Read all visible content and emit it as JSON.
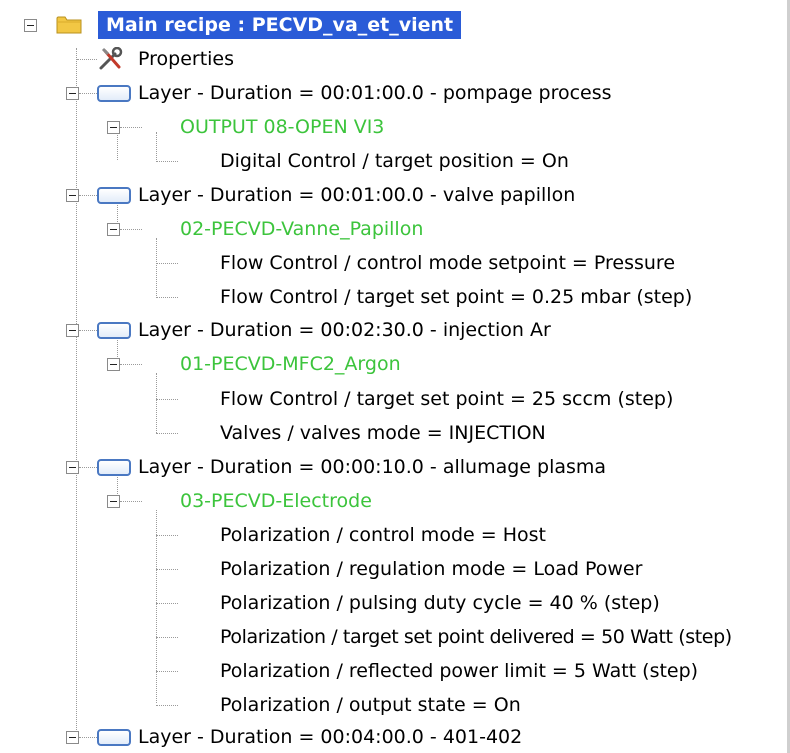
{
  "tree": {
    "root": {
      "label": "Main recipe : PECVD_va_et_vient"
    },
    "properties": {
      "label": "Properties"
    },
    "layers": [
      {
        "label": "Layer - Duration = 00:01:00.0 - pompage process",
        "device": "OUTPUT 08-OPEN VI3",
        "params": [
          "Digital Control / target position = On"
        ]
      },
      {
        "label": "Layer - Duration = 00:01:00.0 - valve papillon",
        "device": "02-PECVD-Vanne_Papillon",
        "params": [
          "Flow Control / control mode setpoint = Pressure",
          "Flow Control / target set point = 0.25 mbar (step)"
        ]
      },
      {
        "label": "Layer - Duration = 00:02:30.0 - injection Ar",
        "device": "01-PECVD-MFC2_Argon",
        "params": [
          "Flow Control / target set point = 25 sccm (step)",
          "Valves / valves mode = INJECTION"
        ]
      },
      {
        "label": "Layer - Duration = 00:00:10.0 - allumage plasma",
        "device": "03-PECVD-Electrode",
        "params": [
          "Polarization / control mode = Host",
          "Polarization / regulation mode = Load Power",
          "Polarization / pulsing duty cycle = 40 % (step)",
          "Polarization / target set point delivered = 50 Watt (step)",
          "Polarization / reflected power limit = 5 Watt (step)",
          "Polarization / output state = On"
        ]
      },
      {
        "label": "Layer - Duration = 00:04:00.0 - 401-402",
        "device": "",
        "params": []
      }
    ]
  },
  "icons": {
    "root_toggle": "collapse-icon",
    "root": "folder-icon",
    "properties": "tools-icon",
    "layer": "layer-icon",
    "device_toggle": "collapse-icon"
  },
  "colors": {
    "selection_bg": "#2a5bd7",
    "selection_text": "#ffffff",
    "device_text": "#3cc43c",
    "layer_icon_border": "#4a78c2",
    "folder": "#f2c744"
  }
}
